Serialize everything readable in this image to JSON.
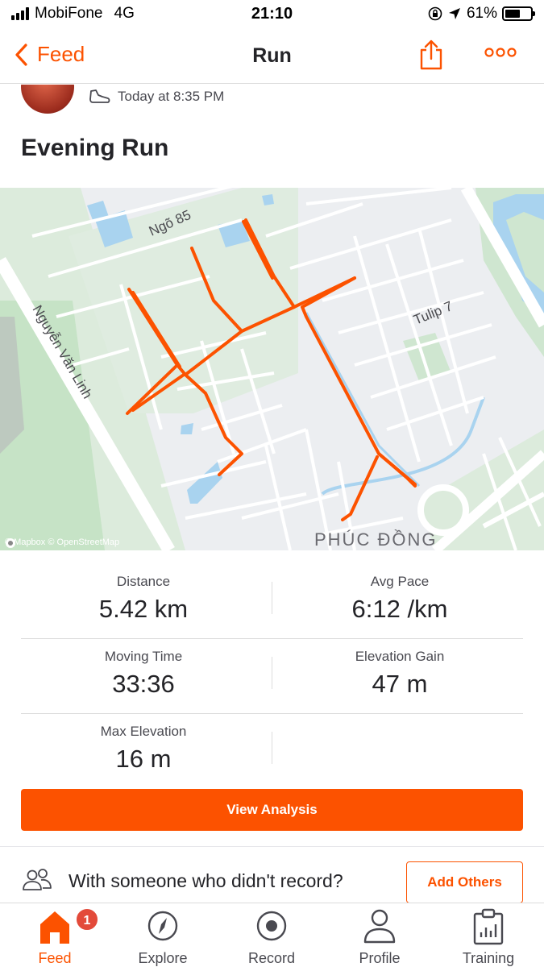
{
  "status_bar": {
    "carrier": "MobiFone",
    "network": "4G",
    "time": "21:10",
    "battery_percent": "61%",
    "battery_level": 0.61
  },
  "nav": {
    "back_label": "Feed",
    "title": "Run"
  },
  "activity": {
    "timestamp": "Today at 8:35 PM",
    "title": "Evening Run"
  },
  "map": {
    "street_labels": [
      "Ngõ 85",
      "Nguyễn Văn Linh",
      "Tulip 7"
    ],
    "area_label": "PHÚC ĐỒNG",
    "attribution": "© Mapbox © OpenStreetMap",
    "route_color": "#fc5200"
  },
  "stats": [
    {
      "label": "Distance",
      "value": "5.42 km"
    },
    {
      "label": "Avg Pace",
      "value": "6:12 /km"
    },
    {
      "label": "Moving Time",
      "value": "33:36"
    },
    {
      "label": "Elevation Gain",
      "value": "47 m"
    },
    {
      "label": "Max Elevation",
      "value": "16 m"
    }
  ],
  "analysis_button": "View Analysis",
  "with_someone": {
    "text": "With someone who didn't record?",
    "button": "Add Others"
  },
  "tabs": [
    {
      "label": "Feed",
      "icon": "home-icon",
      "active": true,
      "badge": "1"
    },
    {
      "label": "Explore",
      "icon": "compass-icon"
    },
    {
      "label": "Record",
      "icon": "record-icon"
    },
    {
      "label": "Profile",
      "icon": "person-icon"
    },
    {
      "label": "Training",
      "icon": "clipboard-chart-icon"
    }
  ],
  "colors": {
    "accent": "#fc5200",
    "text": "#242428",
    "badge": "#e34a3a"
  }
}
